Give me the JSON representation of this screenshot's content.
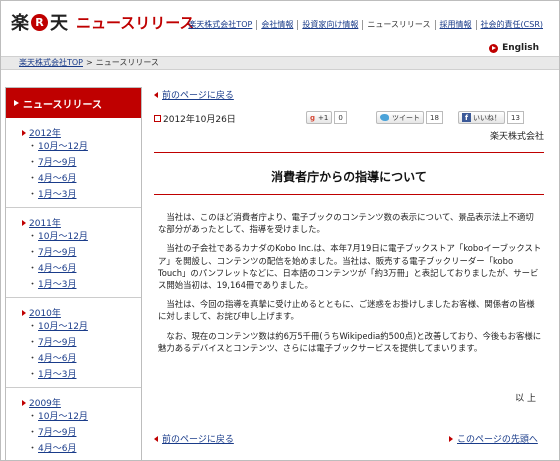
{
  "header": {
    "logo_char1": "楽",
    "logo_r": "R",
    "logo_char2": "天",
    "page_title": "ニュースリリース",
    "nav": [
      {
        "label": "楽天株式会社TOP",
        "link": true
      },
      {
        "label": "会社情報",
        "link": true
      },
      {
        "label": "投資家向け情報",
        "link": true
      },
      {
        "label": "ニュースリリース",
        "link": false
      },
      {
        "label": "採用情報",
        "link": true
      },
      {
        "label": "社会的責任(CSR)",
        "link": true
      }
    ],
    "english": "English"
  },
  "breadcrumb": {
    "home": "楽天株式会社TOP",
    "separator": ">",
    "current": "ニュースリリース"
  },
  "sidebar": {
    "heading": "ニュースリリース",
    "years": [
      {
        "label": "2012年",
        "quarters": [
          "10月〜12月",
          "7月〜9月",
          "4月〜6月",
          "1月〜3月"
        ]
      },
      {
        "label": "2011年",
        "quarters": [
          "10月〜12月",
          "7月〜9月",
          "4月〜6月",
          "1月〜3月"
        ]
      },
      {
        "label": "2010年",
        "quarters": [
          "10月〜12月",
          "7月〜9月",
          "4月〜6月",
          "1月〜3月"
        ]
      },
      {
        "label": "2009年",
        "quarters": [
          "10月〜12月",
          "7月〜9月",
          "4月〜6月"
        ]
      }
    ]
  },
  "main": {
    "back_link": "前のページに戻る",
    "date": "2012年10月26日",
    "social": {
      "gplus_label": "+1",
      "gplus_count": "0",
      "tweet_label": "ツイート",
      "tweet_count": "18",
      "fb_label": "いいね！",
      "fb_count": "13"
    },
    "company": "楽天株式会社",
    "headline": "消費者庁からの指導について",
    "paragraphs": [
      "当社は、このほど消費者庁より、電子ブックのコンテンツ数の表示について、景品表示法上不適切な部分があったとして、指導を受けました。",
      "当社の子会社であるカナダのKobo Inc.は、本年7月19日に電子ブックストア「koboイーブックストア」を開設し、コンテンツの配信を始めました。当社は、販売する電子ブックリーダー「kobo Touch」のパンフレットなどに、日本語のコンテンツが「約3万冊」と表記しておりましたが、サービス開始当初は、19,164冊でありました。",
      "当社は、今回の指導を真摯に受け止めるとともに、ご迷惑をお掛けしましたお客様、関係者の皆様に対しまして、お詫び申し上げます。",
      "なお、現在のコンテンツ数は約6万5千冊(うちWikipedia約500点)と改善しており、今後もお客様に魅力あるデバイスとコンテンツ、さらには電子ブックサービスを提供してまいります。"
    ],
    "closing": "以 上",
    "back_link_bottom": "前のページに戻る",
    "page_top_link": "このページの先頭へ"
  },
  "colors": {
    "brand_red": "#bf0000",
    "link_blue": "#1a3c8a",
    "crumb_bg": "#e9e9e9"
  }
}
